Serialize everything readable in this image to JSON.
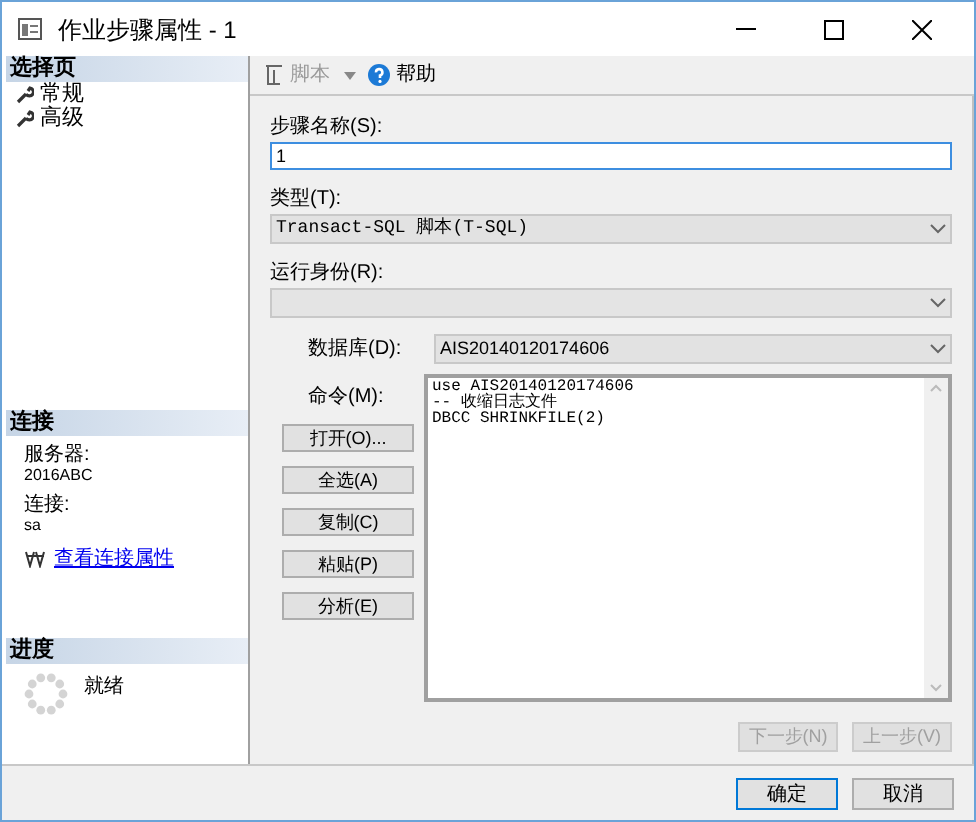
{
  "window": {
    "title": "作业步骤属性 - 1"
  },
  "sidebar": {
    "sections": [
      {
        "header": "选择页",
        "items": [
          {
            "label": "常规"
          },
          {
            "label": "高级"
          }
        ]
      }
    ],
    "connection": {
      "header": "连接",
      "server_label": "服务器:",
      "server": "2016ABC",
      "connection_label": "连接:",
      "connection": "sa",
      "link": "查看连接属性"
    },
    "progress": {
      "header": "进度",
      "status": "就绪"
    }
  },
  "toolbar": [
    {
      "label": "脚本",
      "disabled": true,
      "dropdown": true
    },
    {
      "label": "帮助",
      "disabled": false,
      "dropdown": false
    }
  ],
  "form": {
    "step_name": {
      "label": "步骤名称(S):",
      "value": "1"
    },
    "type": {
      "label": "类型(T):",
      "value": "Transact-SQL 脚本(T-SQL)",
      "disabled": false
    },
    "run_as": {
      "label": "运行身份(R):",
      "disabled": true
    },
    "database": {
      "label": "数据库(D):",
      "value": "AIS20140120174606"
    },
    "command": {
      "label": "命令(M):",
      "lines": [
        "use AIS20140120174606",
        "-- 收缩日志文件",
        "DBCC SHRINKFILE(2)"
      ]
    },
    "command_buttons": [
      "打开(O)...",
      "全选(A)",
      "复制(C)",
      "粘贴(P)",
      "分析(E)"
    ],
    "nav_buttons": [
      {
        "label": "下一步(N)",
        "disabled": true
      },
      {
        "label": "上一步(V)",
        "disabled": true
      }
    ]
  },
  "footer_buttons": [
    {
      "label": "确定",
      "focused": true
    },
    {
      "label": "取消",
      "focused": false
    }
  ]
}
